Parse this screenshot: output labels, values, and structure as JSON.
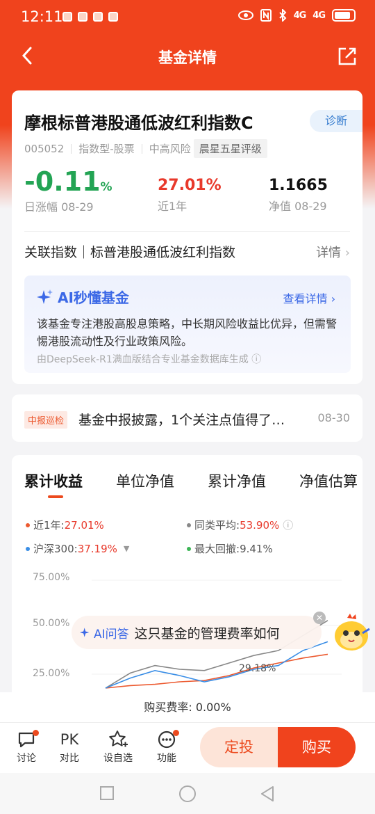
{
  "status": {
    "time": "12:11",
    "net1": "4G",
    "net2": "4G"
  },
  "nav": {
    "title": "基金详情"
  },
  "fund": {
    "name": "摩根标普港股通低波红利指数C",
    "diagnose": "诊断",
    "code": "005052",
    "type": "指数型-股票",
    "risk": "中高风险",
    "rating": "晨星五星评级",
    "day_change": "-0.11",
    "day_change_unit": "%",
    "day_label": "日涨幅 08-29",
    "year_return": "27.01%",
    "year_label": "近1年",
    "nav_value": "1.1665",
    "nav_label": "净值 08-29",
    "assoc_index": "关联指数｜标普港股通低波红利指数",
    "assoc_more": "详情"
  },
  "ai": {
    "title": "AI秒懂基金",
    "more": "查看详情",
    "text": "该基金专注港股高股息策略，中长期风险收益比优异，但需警惕港股流动性及行业政策风险。",
    "foot": "由DeepSeek-R1满血版结合专业基金数据库生成"
  },
  "report": {
    "badge": "中报巡检",
    "text": "基金中报披露，1个关注点值得了…",
    "date": "08-30"
  },
  "chart_tabs": [
    "累计收益",
    "单位净值",
    "累计净值",
    "净值估算"
  ],
  "legend": {
    "l1_label": "近1年:",
    "l1_value": "27.01%",
    "l2_label": "同类平均:",
    "l2_value": "53.90%",
    "l3_label": "沪深300:",
    "l3_value": "37.19%",
    "l4_label": "最大回撤:",
    "l4_value": "9.41%",
    "colors": {
      "fund": "#ec5a30",
      "peer": "#888888",
      "hs300": "#3a8ee6",
      "drawdown": "#3db556"
    }
  },
  "chart_data": {
    "type": "line",
    "yticks": [
      "75.00%",
      "50.00%",
      "25.00%"
    ],
    "annotation": "29.18%",
    "series": [
      {
        "name": "近1年",
        "values": [
          0,
          2,
          3,
          5,
          6,
          10,
          16,
          20,
          24,
          27
        ]
      },
      {
        "name": "同类平均",
        "values": [
          0,
          12,
          18,
          15,
          14,
          20,
          26,
          30,
          42,
          54
        ]
      },
      {
        "name": "沪深300",
        "values": [
          0,
          8,
          14,
          10,
          5,
          9,
          15,
          18,
          30,
          37
        ]
      }
    ]
  },
  "ai_ask": {
    "tag": "AI问答",
    "text": "这只基金的管理费率如何"
  },
  "fee": "购买费率: 0.00%",
  "bottom": {
    "discuss": "讨论",
    "pk_icon": "PK",
    "compare": "对比",
    "watch": "设自选",
    "func": "功能",
    "invest": "定投",
    "buy": "购买"
  }
}
